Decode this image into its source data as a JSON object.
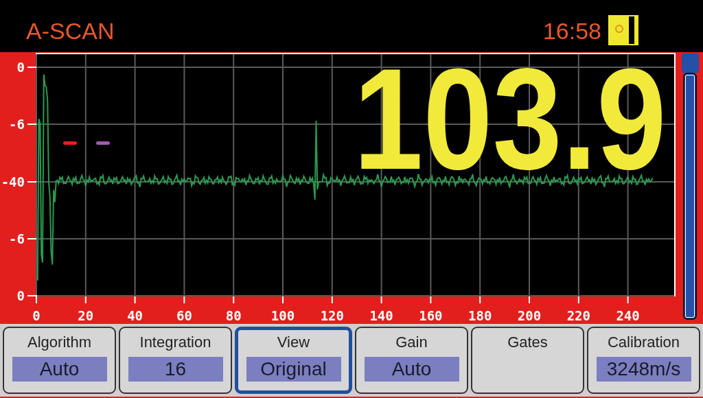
{
  "header": {
    "title": "A-SCAN",
    "time": "16:58"
  },
  "plot": {
    "reading": "103.9",
    "y_ticks": [
      "0",
      "-6",
      "-40",
      "-6",
      "0"
    ],
    "x_ticks": [
      "0",
      "20",
      "40",
      "60",
      "80",
      "100",
      "120",
      "140",
      "160",
      "180",
      "200",
      "220",
      "240"
    ],
    "gates": [
      {
        "color": "#e8201c"
      },
      {
        "color": "#a05ab0"
      }
    ]
  },
  "side_slider": {
    "level": 1
  },
  "buttons": [
    {
      "label": "Algorithm",
      "value": "Auto",
      "selected": false
    },
    {
      "label": "Integration",
      "value": "16",
      "selected": false
    },
    {
      "label": "View",
      "value": "Original",
      "selected": true
    },
    {
      "label": "Gain",
      "value": "Auto",
      "selected": false
    },
    {
      "label": "Gates",
      "selected": false
    },
    {
      "label": "Calibration",
      "value": "3248m/s",
      "selected": false
    }
  ]
}
